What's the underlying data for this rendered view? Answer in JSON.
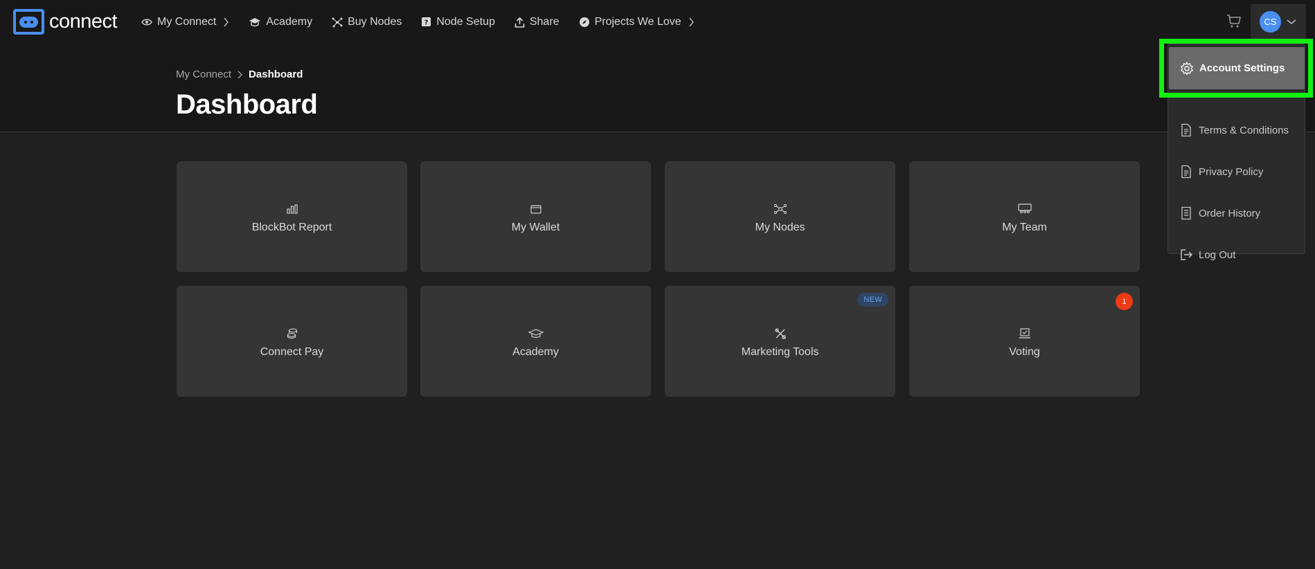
{
  "brand": {
    "logo_text": "connect",
    "accent": "#4a8ff0"
  },
  "nav": {
    "items": [
      {
        "label": "My Connect",
        "icon": "eye-icon",
        "has_chevron": true
      },
      {
        "label": "Academy",
        "icon": "graduation-cap-icon"
      },
      {
        "label": "Buy Nodes",
        "icon": "nodes-icon"
      },
      {
        "label": "Node Setup",
        "icon": "question-box-icon"
      },
      {
        "label": "Share",
        "icon": "share-icon"
      },
      {
        "label": "Projects We Love",
        "icon": "compass-icon",
        "has_chevron": true
      }
    ]
  },
  "user": {
    "initials": "CS"
  },
  "breadcrumb": {
    "parent": "My Connect",
    "current": "Dashboard"
  },
  "page_title": "Dashboard",
  "cards": [
    {
      "label": "BlockBot Report",
      "icon": "bar-chart-icon"
    },
    {
      "label": "My Wallet",
      "icon": "wallet-icon"
    },
    {
      "label": "My Nodes",
      "icon": "network-icon"
    },
    {
      "label": "My Team",
      "icon": "team-icon"
    },
    {
      "label": "Connect Pay",
      "icon": "coins-icon"
    },
    {
      "label": "Academy",
      "icon": "graduation-cap-icon"
    },
    {
      "label": "Marketing Tools",
      "icon": "tools-icon",
      "badge": "NEW"
    },
    {
      "label": "Voting",
      "icon": "ballot-icon",
      "badge_count": "1"
    }
  ],
  "dropdown": {
    "items": [
      {
        "label": "Account Settings",
        "icon": "gear-icon",
        "active": true
      },
      {
        "label": "Terms & Conditions",
        "icon": "document-icon"
      },
      {
        "label": "Privacy Policy",
        "icon": "document-icon"
      },
      {
        "label": "Order History",
        "icon": "receipt-icon"
      },
      {
        "label": "Log Out",
        "icon": "logout-icon"
      }
    ]
  },
  "colors": {
    "background": "#202020",
    "topbar": "#181818",
    "card": "#353535",
    "highlight": "#12f012",
    "badge_new": "#2e4566",
    "badge_count": "#ee3a15"
  }
}
